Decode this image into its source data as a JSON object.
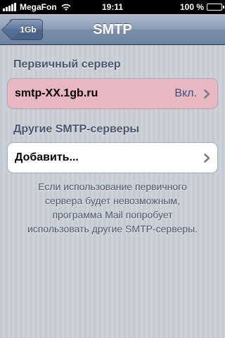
{
  "status_bar": {
    "carrier": "MegaFon",
    "time": "19:11",
    "battery": "100 %",
    "battery_level": 1.0,
    "signal_bars": 5
  },
  "nav": {
    "back_label": "1Gb",
    "title": "SMTP"
  },
  "primary_section": {
    "header": "Первичный сервер",
    "server_name": "smtp-XX.1gb.ru",
    "server_status": "Вкл."
  },
  "other_section": {
    "header": "Другие SMTP-серверы",
    "add_label": "Добавить..."
  },
  "footer": {
    "line1": "Если использование первичного",
    "line2": "сервера будет невозможным,",
    "line3": "программа Mail попробует",
    "line4": "использовать другие SMTP-серверы."
  },
  "colors": {
    "primary_cell_highlight": "#e8b7c0",
    "nav_bar": "#6d84a2",
    "value_text": "#385487"
  },
  "icons": [
    "signal-icon",
    "wifi-icon",
    "battery-icon",
    "chevron-right-icon"
  ]
}
